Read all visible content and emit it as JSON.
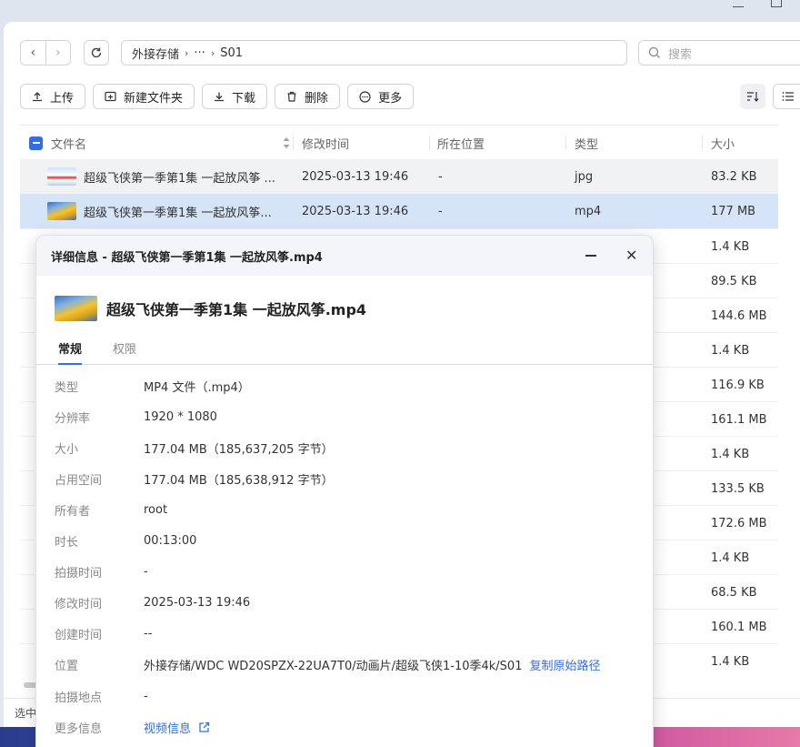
{
  "address": {
    "segments": [
      "外接存储",
      "···",
      "S01"
    ]
  },
  "search": {
    "placeholder": "搜索"
  },
  "toolbar": {
    "upload": "上传",
    "new_folder": "新建文件夹",
    "download": "下载",
    "delete": "删除",
    "more": "更多"
  },
  "table": {
    "headers": {
      "name": "文件名",
      "modified": "修改时间",
      "location": "所在位置",
      "type": "类型",
      "size": "大小"
    },
    "rows": [
      {
        "name": "超级飞侠第一季第1集 一起放风筝 ...",
        "modified": "2025-03-13 19:46",
        "location": "-",
        "type": "jpg",
        "size": "83.2 KB"
      },
      {
        "name": "超级飞侠第一季第1集 一起放风筝...",
        "modified": "2025-03-13 19:46",
        "location": "-",
        "type": "mp4",
        "size": "177 MB"
      }
    ],
    "sizes_more": [
      "1.4 KB",
      "89.5 KB",
      "144.6 MB",
      "1.4 KB",
      "116.9 KB",
      "161.1 MB",
      "1.4 KB",
      "133.5 KB",
      "172.6 MB",
      "1.4 KB",
      "68.5 KB",
      "160.1 MB",
      "1.4 KB"
    ]
  },
  "status": {
    "text": "选中"
  },
  "dialog": {
    "header": "详细信息 - 超级飞侠第一季第1集 一起放风筝.mp4",
    "title": "超级飞侠第一季第1集 一起放风筝.mp4",
    "tabs": [
      "常规",
      "权限"
    ],
    "props": [
      {
        "k": "类型",
        "v": "MP4 文件（.mp4）"
      },
      {
        "k": "分辨率",
        "v": "1920 * 1080"
      },
      {
        "k": "大小",
        "v": "177.04 MB（185,637,205 字节）"
      },
      {
        "k": "占用空间",
        "v": "177.04 MB（185,638,912 字节）"
      },
      {
        "k": "所有者",
        "v": "root"
      },
      {
        "k": "时长",
        "v": "00:13:00"
      },
      {
        "k": "拍摄时间",
        "v": "-"
      },
      {
        "k": "修改时间",
        "v": "2025-03-13 19:46"
      },
      {
        "k": "创建时间",
        "v": "--"
      },
      {
        "k": "位置",
        "v": "外接存储/WDC WD20SPZX-22UA7T0/动画片/超级飞侠1-10季4k/S01"
      },
      {
        "k": "拍摄地点",
        "v": "-"
      },
      {
        "k": "更多信息",
        "v": ""
      }
    ],
    "copy_path": "复制原始路径",
    "video_info": "视频信息"
  }
}
